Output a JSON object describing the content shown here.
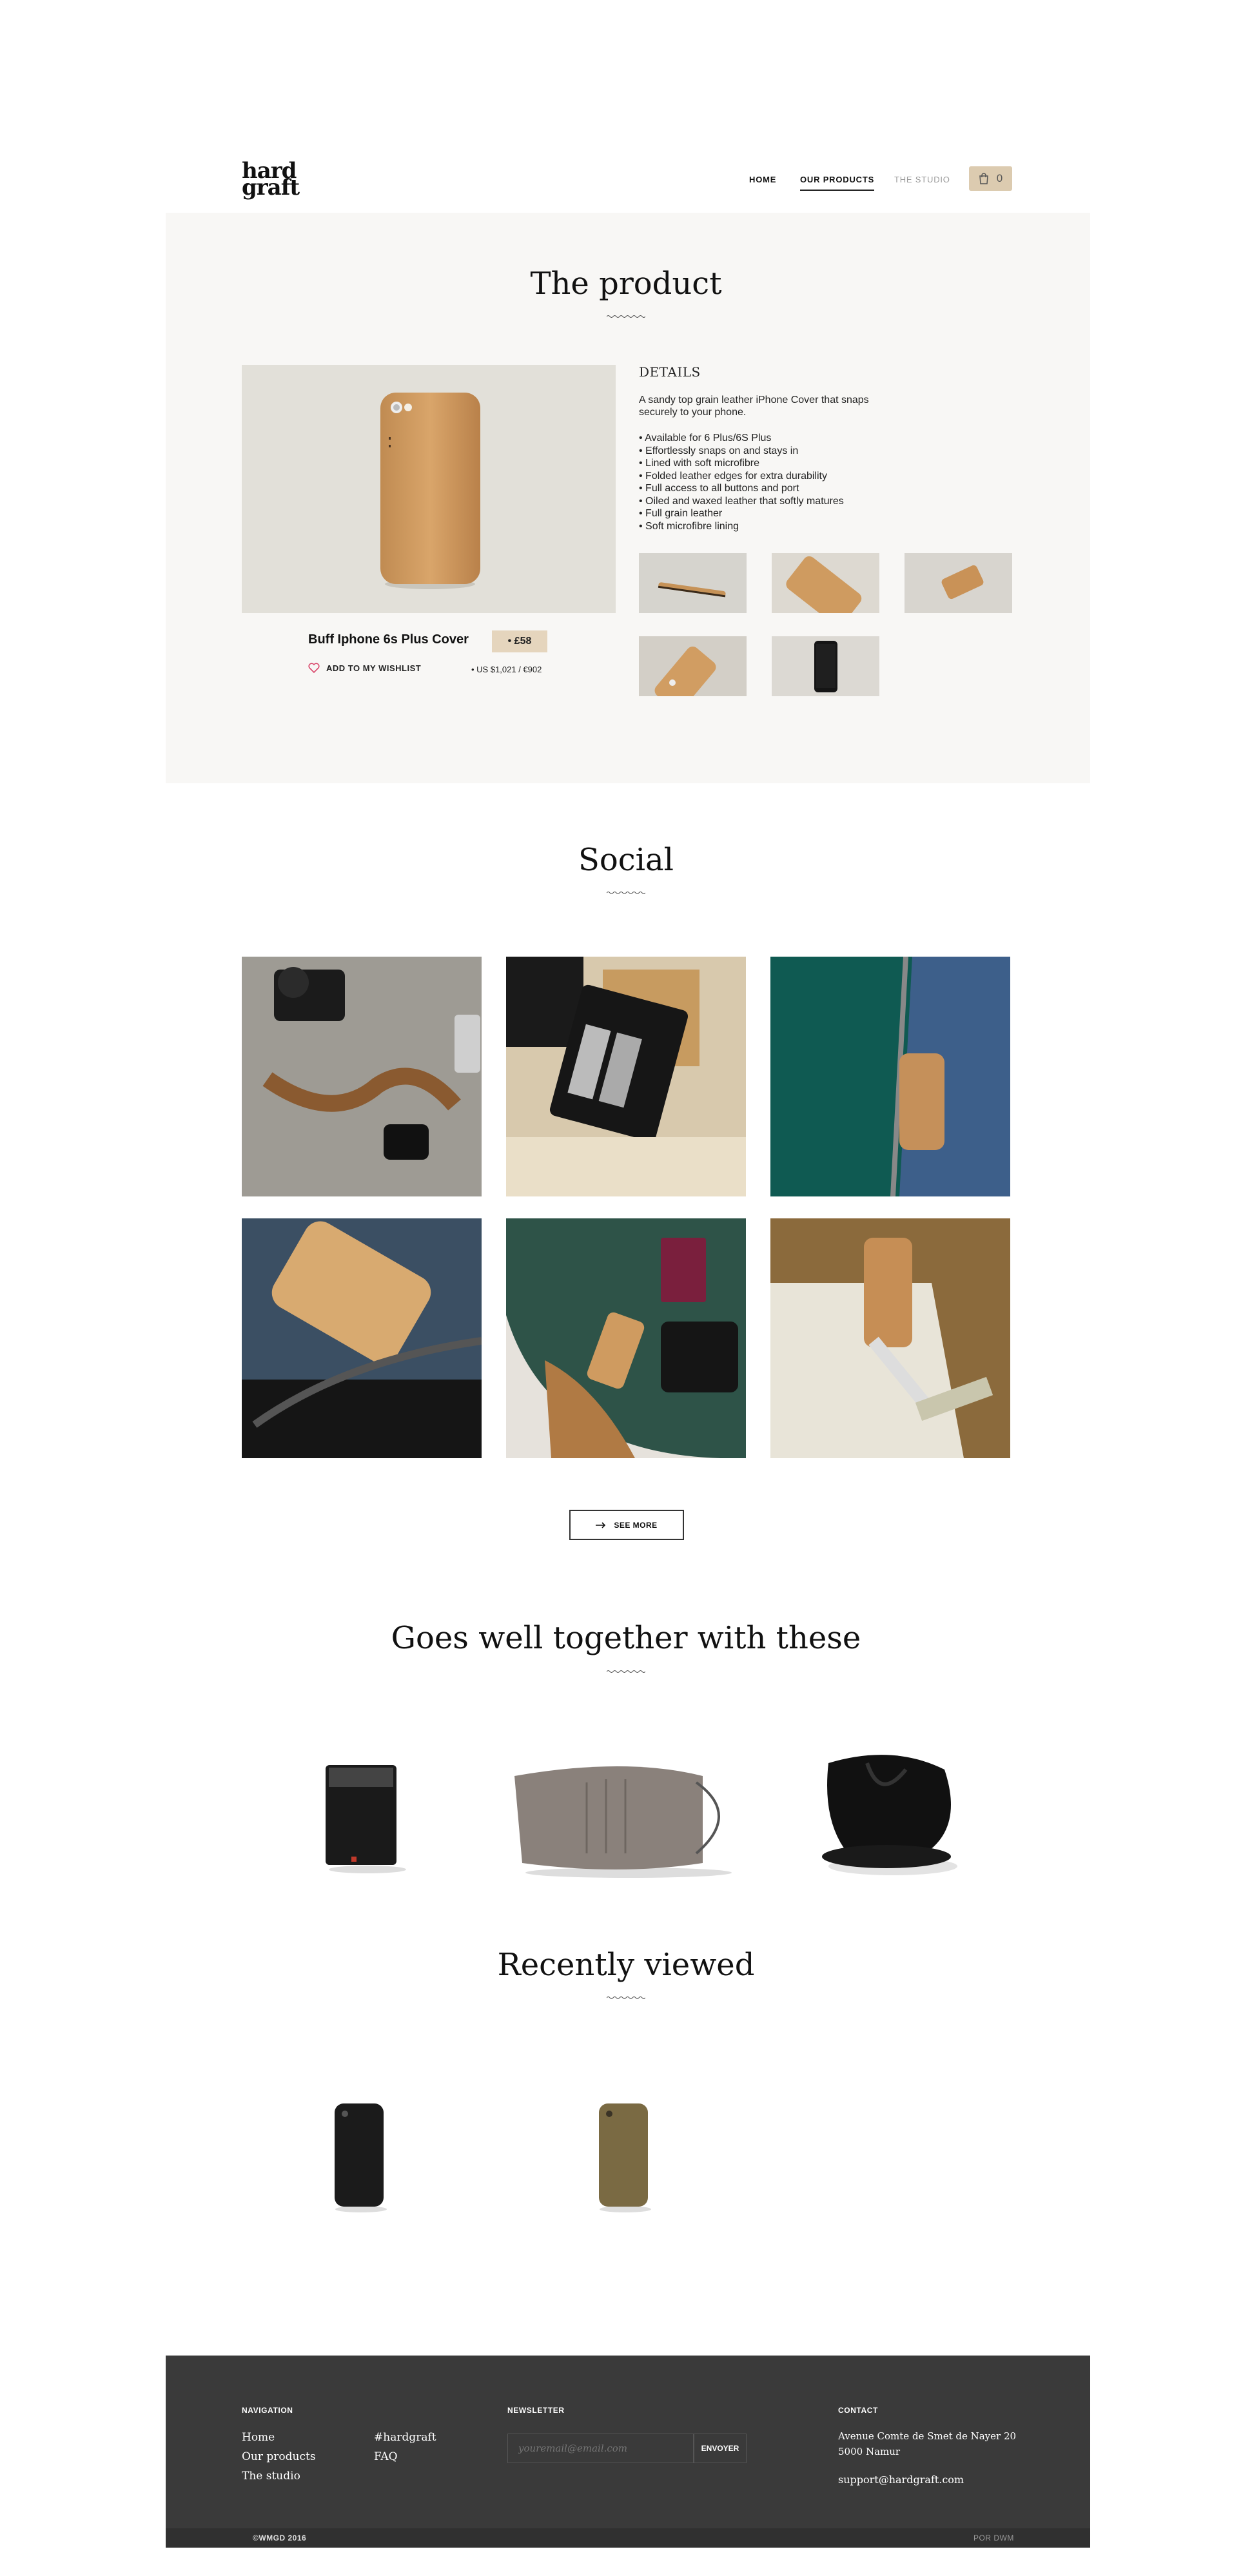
{
  "header": {
    "logo": "hard graft",
    "nav": [
      "HOME",
      "OUR PRODUCTS",
      "THE STUDIO"
    ],
    "cart_count": "0"
  },
  "product_section": {
    "title": "The product",
    "name": "Buff Iphone 6s Plus Cover",
    "price": "• £58",
    "wishlist": "ADD TO MY WISHLIST",
    "alt_price": "• US $1,021 / €902",
    "details_heading": "DETAILS",
    "description": "A sandy top grain leather iPhone Cover that snaps securely to your phone.",
    "features": [
      "• Available for 6 Plus/6S Plus",
      "• Effortlessly snaps on and stays in",
      "• Lined with soft microfibre",
      "• Folded leather edges for extra durability",
      "• Full access to all buttons and port",
      "• Oiled and waxed leather that softly matures",
      "• Full grain leather",
      "• Soft microfibre lining"
    ]
  },
  "social": {
    "title": "Social",
    "see_more": "SEE MORE"
  },
  "together": {
    "title": "Goes well together with these"
  },
  "recent": {
    "title": "Recently viewed"
  },
  "footer": {
    "nav_heading": "NAVIGATION",
    "nav_links": [
      "Home",
      "Our products",
      "The studio"
    ],
    "extra_links": [
      "#hardgraft",
      "FAQ"
    ],
    "newsletter_heading": "NEWSLETTER",
    "email_placeholder": "youremail@email.com",
    "submit": "ENVOYER",
    "contact_heading": "CONTACT",
    "address_line1": "Avenue Comte de Smet de Nayer 20",
    "address_line2": "5000 Namur",
    "email": "support@hardgraft.com",
    "copyright": "©WMGD 2016",
    "credit": "POR DWM"
  },
  "colors": {
    "accent_tan": "#dccbb0",
    "panel_bg": "#f8f7f5",
    "footer_bg": "#3a3a3a",
    "heart": "#d9476b"
  }
}
